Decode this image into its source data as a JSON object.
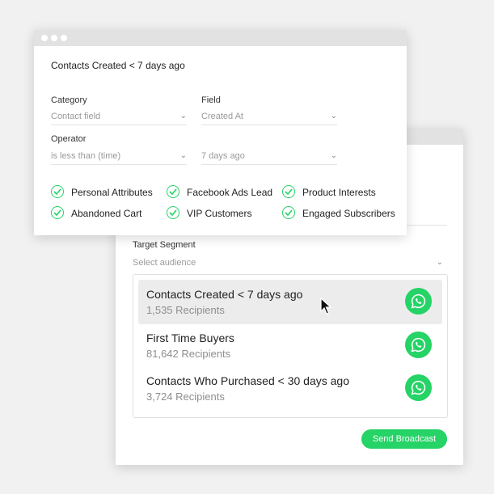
{
  "front_window": {
    "title": "Contacts Created < 7 days ago",
    "category": {
      "label": "Category",
      "value": "Contact field"
    },
    "field": {
      "label": "Field",
      "value": "Created At"
    },
    "operator": {
      "label": "Operator",
      "value": "is less than (time)"
    },
    "time_value": "7 days ago",
    "tags": [
      "Personal Attributes",
      "Facebook Ads Lead",
      "Product Interests",
      "Abandoned Cart",
      "VIP Customers",
      "Engaged Subscribers"
    ]
  },
  "back_window": {
    "target_segment_label": "Target Segment",
    "audience_placeholder": "Select audience",
    "audiences": [
      {
        "name": "Contacts Created < 7 days ago",
        "count": "1,535 Recipients"
      },
      {
        "name": "First Time Buyers",
        "count": "81,642 Recipients"
      },
      {
        "name": "Contacts Who Purchased < 30 days ago",
        "count": "3,724 Recipients"
      }
    ],
    "send_button": "Send Broadcast"
  },
  "colors": {
    "accent": "#25d366",
    "window_bg": "#ffffff",
    "page_bg": "#f1f1f1"
  },
  "icons": {
    "channel": "whatsapp-icon",
    "check": "check-circle-icon",
    "cursor": "mouse-pointer-icon"
  }
}
